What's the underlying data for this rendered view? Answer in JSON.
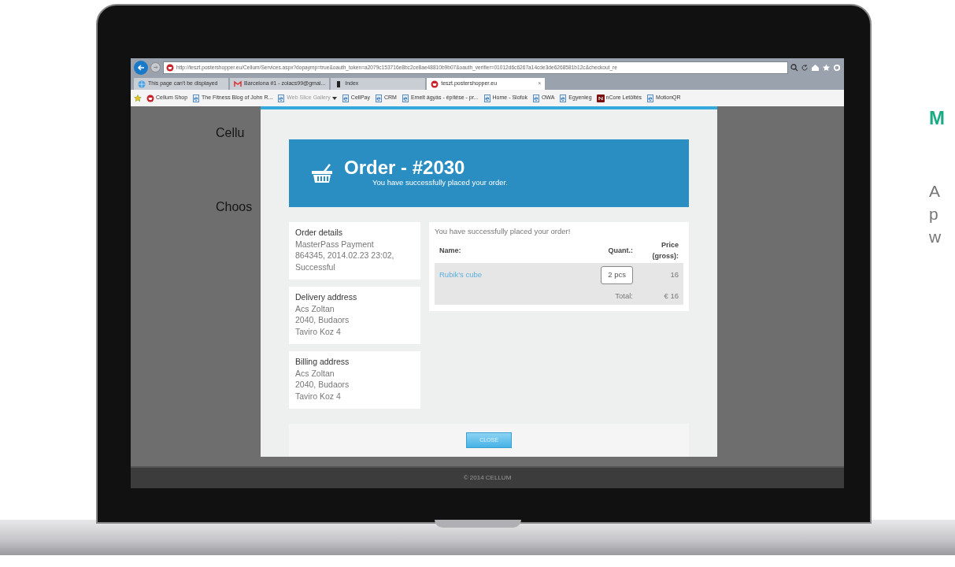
{
  "browser": {
    "address": "http://teszt.postershopper.eu/Cellum/Services.aspx?dopaymp=true&oauth_token=a2079c153716e8bc2ce8ae48810b9b07&oauth_verifier=01012d6c6267a14cde3de6268581b12c&checkout_re",
    "tabs": [
      {
        "label": "This page can't be displayed",
        "kind": "ie",
        "selected": false
      },
      {
        "label": "Barcelona #1 - zolacs99@gmai...",
        "kind": "mail",
        "selected": false
      },
      {
        "label": "Index",
        "kind": "doc",
        "selected": false
      },
      {
        "label": "teszt.postershopper.eu",
        "kind": "shop",
        "selected": true
      }
    ],
    "tab_close": "×",
    "favorites": [
      {
        "label": "Cellum Shop",
        "kind": "shop"
      },
      {
        "label": "The Fitness Blog of John R...",
        "kind": "page"
      },
      {
        "label": "Web Slice Gallery",
        "kind": "gallery"
      },
      {
        "label": "CellPay",
        "kind": "page"
      },
      {
        "label": "CRM",
        "kind": "page"
      },
      {
        "label": "Emelt ágyás - építése - pr...",
        "kind": "page"
      },
      {
        "label": "Home - Siofok",
        "kind": "page"
      },
      {
        "label": "OWA",
        "kind": "page"
      },
      {
        "label": "Egyenleg",
        "kind": "page"
      },
      {
        "label": "nCore Letöltés",
        "kind": "ncore"
      },
      {
        "label": "MotionQR",
        "kind": "page"
      }
    ]
  },
  "site": {
    "logo_text": "Cellu",
    "intro_text": "Choos",
    "footer": "© 2014 CELLUM"
  },
  "order_modal": {
    "title": "Order - #2030",
    "subtitle": "You have successfully placed your order.",
    "details": [
      {
        "heading": "Order details",
        "lines": [
          "MasterPass Payment",
          "864345, 2014.02.23 23:02,",
          "Successful"
        ]
      },
      {
        "heading": "Delivery address",
        "lines": [
          "Acs Zoltan",
          "2040, Budaors",
          "Taviro Koz 4"
        ]
      },
      {
        "heading": "Billing address",
        "lines": [
          "Acs Zoltan",
          "2040, Budaors",
          "Taviro Koz 4"
        ]
      }
    ],
    "summary": {
      "message": "You have successfully placed your order!",
      "columns": [
        "Name:",
        "Quant.:",
        "Price (gross):"
      ],
      "items": [
        {
          "name": "Rubik's cube",
          "quantity": "2 pcs",
          "price": "16"
        }
      ],
      "total_label": "Total:",
      "total": "€ 16"
    },
    "close_button": "CLOSE"
  },
  "side_heading": "M",
  "side_text_lines": [
    "A",
    "p",
    "w"
  ]
}
